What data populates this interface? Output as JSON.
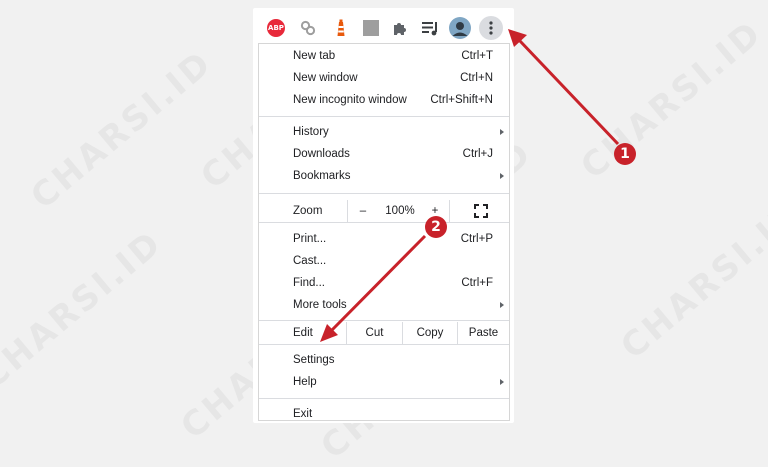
{
  "watermark_text": "CHARSI.ID",
  "toolbar": {
    "extensions": [
      {
        "name": "adblock-plus-icon",
        "label": "ABP",
        "color": "#e8293a"
      },
      {
        "name": "link-icon"
      },
      {
        "name": "lighthouse-icon",
        "color": "#e8590c"
      },
      {
        "name": "gray-square-icon",
        "color": "#9e9e9e"
      },
      {
        "name": "puzzle-piece-icon"
      },
      {
        "name": "media-queue-icon"
      },
      {
        "name": "profile-avatar"
      },
      {
        "name": "more-vertical-icon"
      }
    ]
  },
  "menu": {
    "group1": [
      {
        "label": "New tab",
        "shortcut": "Ctrl+T"
      },
      {
        "label": "New window",
        "shortcut": "Ctrl+N"
      },
      {
        "label": "New incognito window",
        "shortcut": "Ctrl+Shift+N"
      }
    ],
    "group2": [
      {
        "label": "History",
        "submenu": true
      },
      {
        "label": "Downloads",
        "shortcut": "Ctrl+J"
      },
      {
        "label": "Bookmarks",
        "submenu": true
      }
    ],
    "zoom": {
      "label": "Zoom",
      "minus": "–",
      "value": "100%",
      "plus": "+"
    },
    "group3": [
      {
        "label": "Print...",
        "shortcut": "Ctrl+P"
      },
      {
        "label": "Cast..."
      },
      {
        "label": "Find...",
        "shortcut": "Ctrl+F"
      },
      {
        "label": "More tools",
        "submenu": true
      }
    ],
    "edit": {
      "label": "Edit",
      "cut": "Cut",
      "copy": "Copy",
      "paste": "Paste"
    },
    "group4": [
      {
        "label": "Settings"
      },
      {
        "label": "Help",
        "submenu": true
      }
    ],
    "group5": [
      {
        "label": "Exit"
      }
    ]
  },
  "annotations": {
    "step1": "1",
    "step2": "2",
    "color": "#c8222a"
  }
}
